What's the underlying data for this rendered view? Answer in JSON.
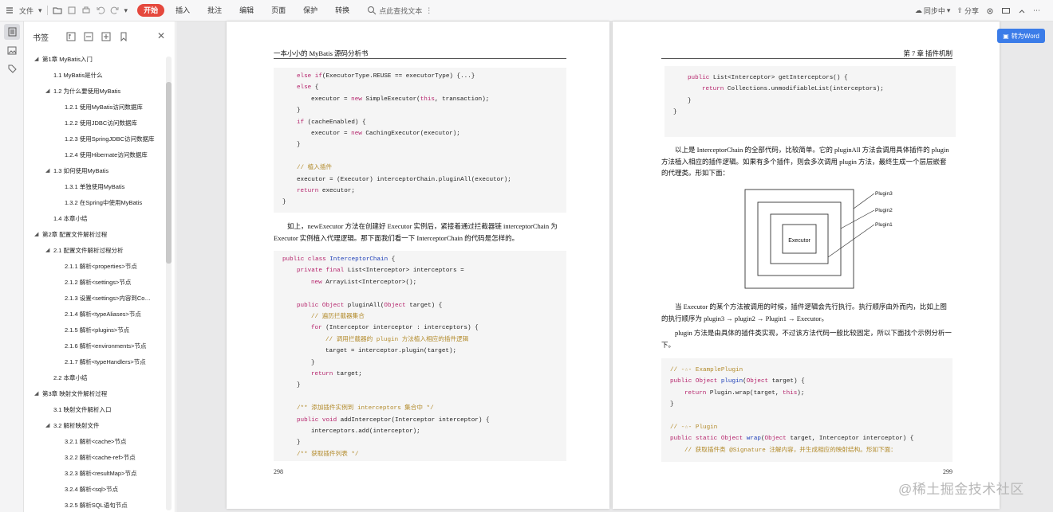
{
  "toolbar": {
    "file_label": "文件",
    "menus": [
      "开始",
      "插入",
      "批注",
      "编辑",
      "页面",
      "保护",
      "转换"
    ],
    "active_menu": "开始",
    "search_label": "点此查找文本",
    "sync_label": "同步中",
    "share_label": "分享",
    "accent": "#e5483d"
  },
  "sidebar": {
    "title": "书签",
    "items": [
      {
        "label": "第1章 MyBatis入门",
        "level": 0,
        "arrow": true
      },
      {
        "label": "1.1 MyBatis是什么",
        "level": 1,
        "arrow": false
      },
      {
        "label": "1.2 为什么要使用MyBatis",
        "level": 1,
        "arrow": true
      },
      {
        "label": "1.2.1 使用MyBatis访问数据库",
        "level": 2,
        "arrow": false
      },
      {
        "label": "1.2.2 使用JDBC访问数据库",
        "level": 2,
        "arrow": false
      },
      {
        "label": "1.2.3 使用SpringJDBC访问数据库",
        "level": 2,
        "arrow": false
      },
      {
        "label": "1.2.4 使用Hibernate访问数据库",
        "level": 2,
        "arrow": false
      },
      {
        "label": "1.3 如何使用MyBatis",
        "level": 1,
        "arrow": true
      },
      {
        "label": "1.3.1 单独使用MyBatis",
        "level": 2,
        "arrow": false
      },
      {
        "label": "1.3.2 在Spring中使用MyBatis",
        "level": 2,
        "arrow": false
      },
      {
        "label": "1.4 本章小结",
        "level": 1,
        "arrow": false
      },
      {
        "label": "第2章 配置文件解析过程",
        "level": 0,
        "arrow": true
      },
      {
        "label": "2.1 配置文件解析过程分析",
        "level": 1,
        "arrow": true
      },
      {
        "label": "2.1.1 解析<properties>节点",
        "level": 2,
        "arrow": false
      },
      {
        "label": "2.1.2 解析<settings>节点",
        "level": 2,
        "arrow": false
      },
      {
        "label": "2.1.3 设置<settings>内容到Co…",
        "level": 2,
        "arrow": false
      },
      {
        "label": "2.1.4 解析<typeAliases>节点",
        "level": 2,
        "arrow": false
      },
      {
        "label": "2.1.5 解析<plugins>节点",
        "level": 2,
        "arrow": false
      },
      {
        "label": "2.1.6 解析<environments>节点",
        "level": 2,
        "arrow": false
      },
      {
        "label": "2.1.7 解析<typeHandlers>节点",
        "level": 2,
        "arrow": false
      },
      {
        "label": "2.2 本章小结",
        "level": 1,
        "arrow": false
      },
      {
        "label": "第3章 映射文件解析过程",
        "level": 0,
        "arrow": true
      },
      {
        "label": "3.1 映射文件解析入口",
        "level": 1,
        "arrow": false
      },
      {
        "label": "3.2 解析映射文件",
        "level": 1,
        "arrow": true
      },
      {
        "label": "3.2.1 解析<cache>节点",
        "level": 2,
        "arrow": false
      },
      {
        "label": "3.2.2 解析<cache-ref>节点",
        "level": 2,
        "arrow": false
      },
      {
        "label": "3.2.3 解析<resultMap>节点",
        "level": 2,
        "arrow": false
      },
      {
        "label": "3.2.4 解析<sql>节点",
        "level": 2,
        "arrow": false
      },
      {
        "label": "3.2.5 解析SQL语句节点",
        "level": 2,
        "arrow": false
      }
    ]
  },
  "left_page": {
    "header": "一本小小的 MyBatis 源码分析书",
    "page_number": "298",
    "code1": [
      {
        "i": 1,
        "t": [
          [
            "kw",
            "else if"
          ],
          [
            "",
            "(ExecutorType.REUSE == executorType) {...}"
          ]
        ]
      },
      {
        "i": 1,
        "t": [
          [
            "kw",
            "else"
          ],
          [
            "",
            " {"
          ]
        ]
      },
      {
        "i": 2,
        "t": [
          [
            "",
            "executor = "
          ],
          [
            "kw",
            "new"
          ],
          [
            "",
            " SimpleExecutor("
          ],
          [
            "kw",
            "this"
          ],
          [
            "",
            ", transaction);"
          ]
        ]
      },
      {
        "i": 1,
        "t": [
          [
            "",
            "}"
          ]
        ]
      },
      {
        "i": 1,
        "t": [
          [
            "kw",
            "if"
          ],
          [
            "",
            " (cacheEnabled) {"
          ]
        ]
      },
      {
        "i": 2,
        "t": [
          [
            "",
            "executor = "
          ],
          [
            "kw",
            "new"
          ],
          [
            "",
            " CachingExecutor(executor);"
          ]
        ]
      },
      {
        "i": 1,
        "t": [
          [
            "",
            "}"
          ]
        ]
      },
      {
        "i": 1,
        "t": [
          [
            "",
            ""
          ]
        ]
      },
      {
        "i": 1,
        "t": [
          [
            "cm",
            "// 植入插件"
          ]
        ]
      },
      {
        "i": 1,
        "t": [
          [
            "",
            "executor = (Executor) interceptorChain.pluginAll(executor);"
          ]
        ]
      },
      {
        "i": 1,
        "t": [
          [
            "kw",
            "return"
          ],
          [
            "",
            " executor;"
          ]
        ]
      },
      {
        "i": 0,
        "t": [
          [
            "",
            "}"
          ]
        ]
      }
    ],
    "para": "如上，newExecutor 方法在创建好 Executor 实例后，紧接着通过拦截器链 interceptorChain 为 Executor 实例植入代理逻辑。那下面我们看一下 InterceptorChain 的代码是怎样的。",
    "code2": [
      {
        "i": 0,
        "t": [
          [
            "kw",
            "public class"
          ],
          [
            "",
            " "
          ],
          [
            "ty",
            "InterceptorChain"
          ],
          [
            "",
            " {"
          ]
        ]
      },
      {
        "i": 1,
        "t": [
          [
            "kw",
            "private final"
          ],
          [
            "",
            " List<Interceptor> interceptors ="
          ]
        ]
      },
      {
        "i": 2,
        "t": [
          [
            "kw",
            "new"
          ],
          [
            "",
            " ArrayList<Interceptor>();"
          ]
        ]
      },
      {
        "i": 1,
        "t": [
          [
            "",
            ""
          ]
        ]
      },
      {
        "i": 1,
        "t": [
          [
            "kw",
            "public"
          ],
          [
            "",
            " "
          ],
          [
            "kw",
            "Object"
          ],
          [
            "",
            " pluginAll("
          ],
          [
            "kw",
            "Object"
          ],
          [
            "",
            " target) {"
          ]
        ]
      },
      {
        "i": 2,
        "t": [
          [
            "cm",
            "// 遍历拦截器集合"
          ]
        ]
      },
      {
        "i": 2,
        "t": [
          [
            "kw",
            "for"
          ],
          [
            "",
            " (Interceptor interceptor : interceptors) {"
          ]
        ]
      },
      {
        "i": 3,
        "t": [
          [
            "cm",
            "// 调用拦截器的 plugin 方法植入相应的插件逻辑"
          ]
        ]
      },
      {
        "i": 3,
        "t": [
          [
            "",
            "target = interceptor.plugin(target);"
          ]
        ]
      },
      {
        "i": 2,
        "t": [
          [
            "",
            "}"
          ]
        ]
      },
      {
        "i": 2,
        "t": [
          [
            "kw",
            "return"
          ],
          [
            "",
            " target;"
          ]
        ]
      },
      {
        "i": 1,
        "t": [
          [
            "",
            "}"
          ]
        ]
      },
      {
        "i": 1,
        "t": [
          [
            "",
            ""
          ]
        ]
      },
      {
        "i": 1,
        "t": [
          [
            "cm",
            "/** 添加插件实例到 interceptors 集合中 */"
          ]
        ]
      },
      {
        "i": 1,
        "t": [
          [
            "kw",
            "public void"
          ],
          [
            "",
            " addInterceptor(Interceptor interceptor) {"
          ]
        ]
      },
      {
        "i": 2,
        "t": [
          [
            "",
            "interceptors.add(interceptor);"
          ]
        ]
      },
      {
        "i": 1,
        "t": [
          [
            "",
            "}"
          ]
        ]
      },
      {
        "i": 1,
        "t": [
          [
            "cm",
            "/** 获取插件列表 */"
          ]
        ]
      }
    ]
  },
  "right_page": {
    "header": "第 7 章  插件机制",
    "page_number": "299",
    "code1": [
      {
        "i": 1,
        "t": [
          [
            "kw",
            "public"
          ],
          [
            "",
            " List<Interceptor> getInterceptors() {"
          ]
        ]
      },
      {
        "i": 2,
        "t": [
          [
            "kw",
            "return"
          ],
          [
            "",
            " Collections.unmodifiableList(interceptors);"
          ]
        ]
      },
      {
        "i": 1,
        "t": [
          [
            "",
            "}"
          ]
        ]
      },
      {
        "i": 0,
        "t": [
          [
            "",
            "}"
          ]
        ]
      }
    ],
    "para1": "以上是 InterceptorChain 的全部代码，比较简单。它的 pluginAll 方法会调用具体插件的 plugin 方法植入相应的插件逻辑。如果有多个插件，则会多次调用 plugin 方法，最终生成一个层层嵌套的代理类。形如下面：",
    "diagram": {
      "center": "Executor",
      "labels": [
        "Plugin3",
        "Plugin2",
        "Plugin1"
      ]
    },
    "para2": "当 Executor 的某个方法被调用的时候，插件逻辑会先行执行。执行顺序由外而内，比如上图的执行顺序为 plugin3 → plugin2 → Plugin1 → Executor。",
    "para3": "plugin 方法是由具体的插件类实现，不过该方法代码一般比较固定，所以下面找个示例分析一下。",
    "code2": [
      {
        "i": 0,
        "t": [
          [
            "cm",
            "// -☆- ExamplePlugin"
          ]
        ]
      },
      {
        "i": 0,
        "t": [
          [
            "kw",
            "public"
          ],
          [
            "",
            " "
          ],
          [
            "kw",
            "Object"
          ],
          [
            "",
            " "
          ],
          [
            "ty",
            "plugin"
          ],
          [
            "",
            "("
          ],
          [
            "kw",
            "Object"
          ],
          [
            "",
            " target) {"
          ]
        ]
      },
      {
        "i": 1,
        "t": [
          [
            "kw",
            "return"
          ],
          [
            "",
            " Plugin.wrap(target, "
          ],
          [
            "kw",
            "this"
          ],
          [
            "",
            ");"
          ]
        ]
      },
      {
        "i": 0,
        "t": [
          [
            "",
            "}"
          ]
        ]
      },
      {
        "i": 0,
        "t": [
          [
            "",
            ""
          ]
        ]
      },
      {
        "i": 0,
        "t": [
          [
            "cm",
            "// -☆- Plugin"
          ]
        ]
      },
      {
        "i": 0,
        "t": [
          [
            "kw",
            "public static"
          ],
          [
            "",
            " "
          ],
          [
            "kw",
            "Object"
          ],
          [
            "",
            " "
          ],
          [
            "ty",
            "wrap"
          ],
          [
            "",
            "("
          ],
          [
            "kw",
            "Object"
          ],
          [
            "",
            " target, Interceptor interceptor) {"
          ]
        ]
      },
      {
        "i": 1,
        "t": [
          [
            "cm",
            "// 获取插件类 @Signature 注解内容，并生成相应的映射结构。形如下面："
          ]
        ]
      }
    ]
  },
  "convert_button": "转为Word",
  "watermark": "@稀土掘金技术社区"
}
